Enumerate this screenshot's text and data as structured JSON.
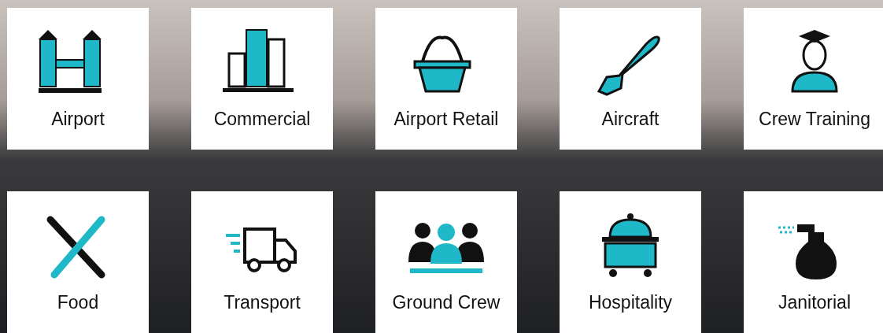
{
  "tiles": [
    {
      "label": "Airport"
    },
    {
      "label": "Commercial"
    },
    {
      "label": "Airport Retail"
    },
    {
      "label": "Aircraft"
    },
    {
      "label": "Crew Training"
    },
    {
      "label": "Food"
    },
    {
      "label": "Transport"
    },
    {
      "label": "Ground Crew"
    },
    {
      "label": "Hospitality"
    },
    {
      "label": "Janitorial"
    }
  ]
}
